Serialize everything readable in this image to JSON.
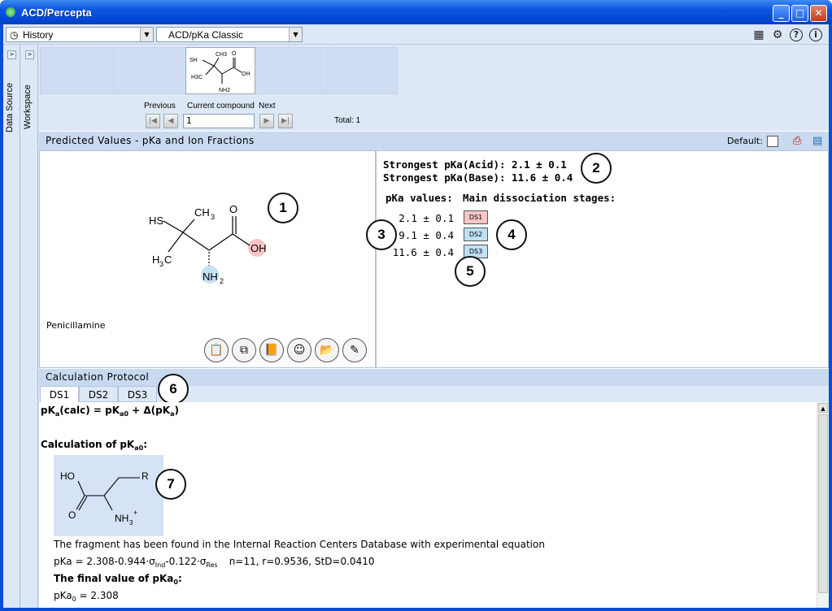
{
  "window": {
    "title": "ACD/Percepta",
    "controls": [
      "minimize",
      "maximize",
      "close"
    ]
  },
  "toolbar": {
    "history_combo": "History",
    "module_combo": "ACD/pKa Classic",
    "icons": [
      "calculator-icon",
      "settings-icon",
      "help-icon",
      "info-icon"
    ]
  },
  "side_tabs": {
    "data_source": "Data Source",
    "workspace": "Workspace"
  },
  "navigator": {
    "previous_label": "Previous",
    "current_label": "Current compound",
    "next_label": "Next",
    "current_value": "1",
    "total": "Total: 1",
    "thumb_labels": {
      "sh": "SH",
      "ch3": "CH3",
      "h3c": "H3C",
      "o": "O",
      "oh": "OH",
      "nh2": "NH2"
    }
  },
  "predicted": {
    "header": "Predicted Values - pKa and Ion Fractions",
    "default_label": "Default:",
    "compound_name": "Penicillamine",
    "structure_labels": {
      "hs": "HS",
      "ch3": "CH",
      "ch3_sub": "3",
      "h3c": "H",
      "h3c_sub": "3",
      "h3c_c": "C",
      "o": "O",
      "oh": "OH",
      "nh2": "NH",
      "nh2_sub": "2"
    },
    "strongest_acid": "Strongest pKa(Acid): 2.1 ± 0.1",
    "strongest_base": "Strongest pKa(Base): 11.6 ± 0.4",
    "pka_values_header": "pKa values:",
    "stages_header": "Main dissociation stages:",
    "pka_values": [
      "2.1 ± 0.1",
      "9.1 ± 0.4",
      "11.6 ± 0.4"
    ],
    "stages": [
      {
        "label": "DS1",
        "color": "#f6c5c5"
      },
      {
        "label": "DS2",
        "color": "#bfe0f4"
      },
      {
        "label": "DS3",
        "color": "#bfe0f4"
      }
    ],
    "action_icons": [
      "clipboard-copy-icon",
      "copy-image-icon",
      "book-icon",
      "smiley-icon",
      "open-folder-icon",
      "edit-pencil-icon"
    ]
  },
  "callouts": [
    "1",
    "2",
    "3",
    "4",
    "5",
    "6",
    "7"
  ],
  "protocol": {
    "header": "Calculation Protocol",
    "tabs": [
      "DS1",
      "DS2",
      "DS3"
    ],
    "equation": "pK(calc) = pK + Δ(pK)",
    "calc_of": "Calculation of pK",
    "calc_of_sub": "a0",
    "fragment_labels": {
      "ho": "HO",
      "r": "R",
      "o": "O",
      "nh3": "NH",
      "nh3_sub": "3",
      "plus": "+"
    },
    "found_text": "The fragment has been found in the Internal Reaction Centers Database with experimental equation",
    "equation2": "pKa = 2.308-0.944·σ",
    "eq2_sub1": "Ind",
    "eq2_mid": "-0.122·σ",
    "eq2_sub2": "Res",
    "eq2_stats": "n=11, r=0.9536, StD=0.0410",
    "final_label": "The final value of pKa",
    "final_sub": "0",
    "final_value_prefix": "pKa",
    "final_value_sub": "0",
    "final_value": " = 2.308"
  }
}
